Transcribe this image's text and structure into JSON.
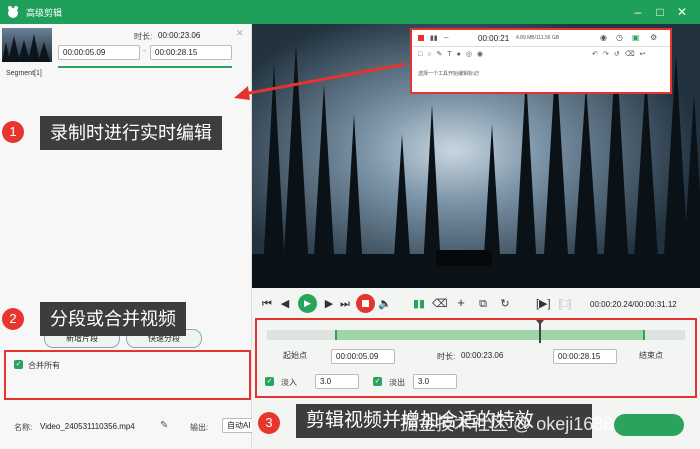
{
  "window": {
    "title": "高级剪辑"
  },
  "clip": {
    "duration_label": "时长:",
    "duration": "00:00:23.06",
    "start": "00:00:05.09",
    "end": "00:00:28.15",
    "segment_label": "Segment[1]"
  },
  "left_buttons": {
    "new_segment": "新增片段",
    "quick_split": "快速分段",
    "merge_all": "合并所有"
  },
  "file": {
    "name_label": "名称:",
    "name": "Video_240531110356.mp4",
    "output_label": "输出:",
    "output_value": "自动AI"
  },
  "overlay": {
    "time": "00:00:21",
    "size": "4.89 MB/111.56 GB",
    "hint": "选择一个工具开始编辑标记!"
  },
  "playback": {
    "time": "00:00:20.24/00:00:31.12"
  },
  "trim": {
    "start_btn": "起始点",
    "start": "00:00:05.09",
    "duration_label": "时长:",
    "duration": "00:00:23.06",
    "end": "00:00:28.15",
    "end_btn": "结束点",
    "fade_in_label": "淡入",
    "fade_in": "3.0",
    "fade_out_label": "淡出",
    "fade_out": "3.0"
  },
  "annotations": [
    {
      "num": "1",
      "text": "录制时进行实时编辑"
    },
    {
      "num": "2",
      "text": "分段或合并视频"
    },
    {
      "num": "3",
      "text": "剪辑视频并增加合适的特效"
    }
  ],
  "watermark": "掘金技术社区 @ okeji1688",
  "colors": {
    "brand": "#1fa05a",
    "annotation_red": "#e5332d"
  }
}
